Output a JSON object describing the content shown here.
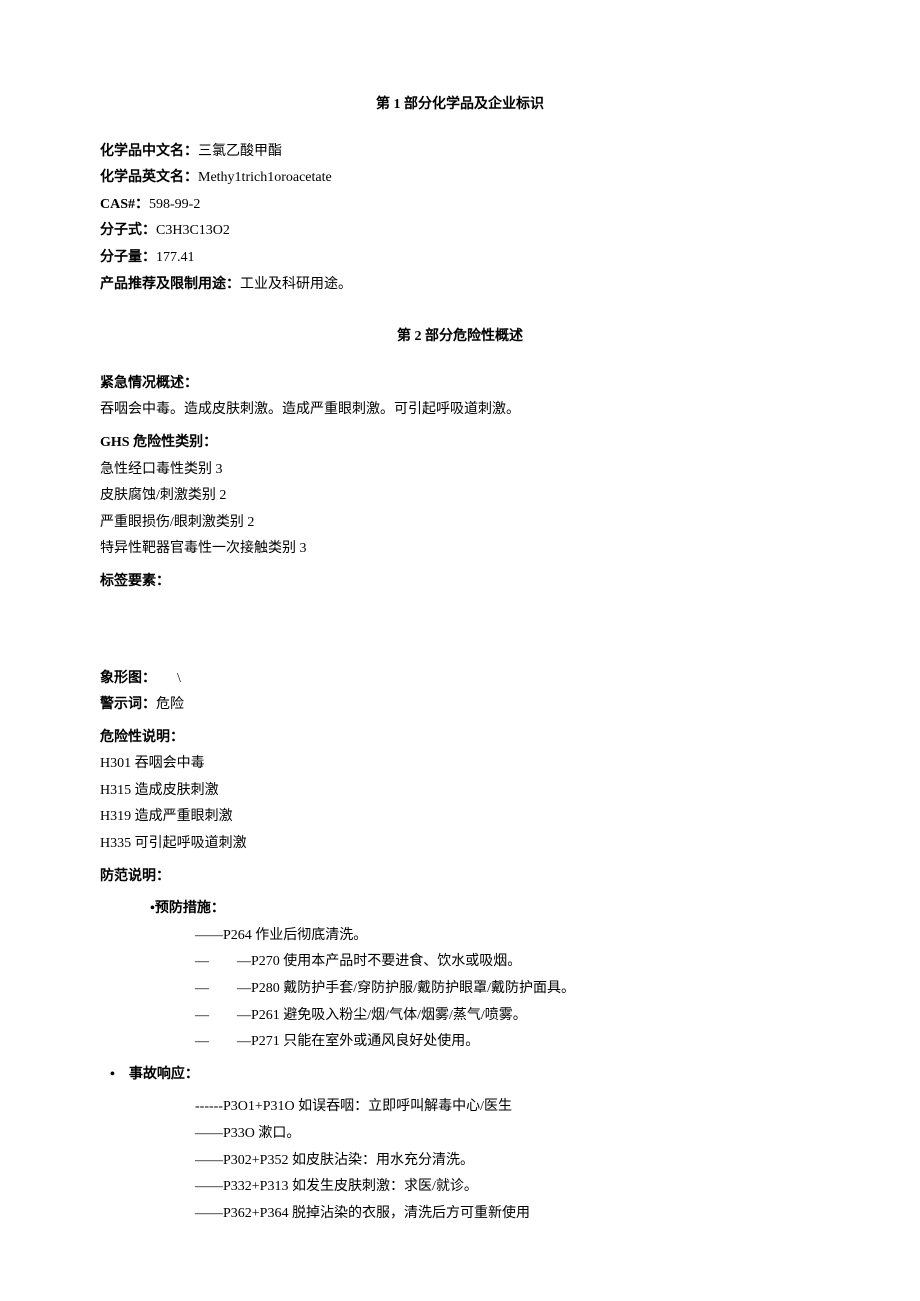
{
  "section1": {
    "title": "第 1 部分化学品及企业标识",
    "name_cn_label": "化学品中文名：",
    "name_cn": "三氯乙酸甲酯",
    "name_en_label": "化学品英文名：",
    "name_en": "Methy1trich1oroacetate",
    "cas_label": "CAS#：",
    "cas": "598-99-2",
    "formula_label": "分子式：",
    "formula": "C3H3C13O2",
    "mw_label": "分子量：",
    "mw": "177.41",
    "use_label": "产品推荐及限制用途：",
    "use": "工业及科研用途。"
  },
  "section2": {
    "title": "第 2 部分危险性概述",
    "emergency_label": "紧急情况概述：",
    "emergency": "吞咽会中毒。造成皮肤刺激。造成严重眼刺激。可引起呼吸道刺激。",
    "ghs_label": "GHS 危险性类别：",
    "ghs": [
      "急性经口毒性类别 3",
      "皮肤腐蚀/刺激类别 2",
      "严重眼损伤/眼刺激类别 2",
      "特异性靶器官毒性一次接触类别 3"
    ],
    "label_elements": "标签要素：",
    "pictogram_label": "象形图：",
    "pictogram": "\\",
    "signal_label": "警示词：",
    "signal": "危险",
    "hazard_label": "危险性说明：",
    "hazards": [
      "H301 吞咽会中毒",
      "H315 造成皮肤刺激",
      "H319 造成严重眼刺激",
      "H335 可引起呼吸道刺激"
    ],
    "precaution_label": "防范说明：",
    "prevention_label": "•预防措施：",
    "prevention": [
      "——P264 作业后彻底清洗。",
      "—　　—P270 使用本产品时不要进食、饮水或吸烟。",
      "—　　—P280 戴防护手套/穿防护服/戴防护眼罩/戴防护面具。",
      "—　　—P261 避免吸入粉尘/烟/气体/烟雾/蒸气/喷雾。",
      "—　　—P271 只能在室外或通风良好处使用。"
    ],
    "response_label": "•　事故响应：",
    "response": [
      "------P3O1+P31O 如误吞咽：立即呼叫解毒中心/医生",
      "——P33O 漱口。",
      "——P302+P352 如皮肤沾染：用水充分清洗。",
      "——P332+P313 如发生皮肤刺激：求医/就诊。",
      "——P362+P364 脱掉沾染的衣服，清洗后方可重新使用"
    ]
  }
}
